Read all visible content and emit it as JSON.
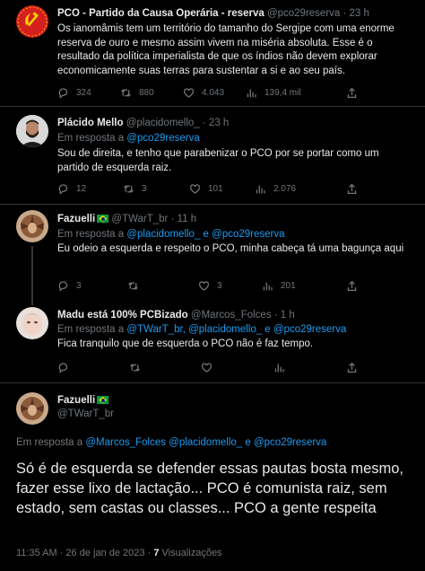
{
  "tweets": [
    {
      "name": "PCO - Partido da Causa Operária - reserva",
      "handle": "@pco29reserva",
      "time": "· 23 h",
      "text": "Os ianomâmis tem um território do tamanho do Sergipe com uma enorme reserva de ouro e mesmo assim vivem na miséria absoluta. Esse é o resultado da política imperialista de que os índios não devem explorar economicamente suas terras para sustentar a si e ao seu país.",
      "replies": "324",
      "retweets": "880",
      "likes": "4.043",
      "views": "139,4 mil"
    },
    {
      "name": "Plácido Mello",
      "handle": "@placidomello_",
      "time": "· 23 h",
      "reply_prefix": "Em resposta a",
      "reply_links": "@pco29reserva",
      "text": "Sou de direita, e tenho que parabenizar o PCO por se portar como um partido de esquerda raiz.",
      "replies": "12",
      "retweets": "3",
      "likes": "101",
      "views": "2.076"
    },
    {
      "name": "Fazuelli",
      "handle": "@TWarT_br",
      "time": "· 11 h",
      "reply_prefix": "Em resposta a",
      "reply_links": "@placidomello_ e @pco29reserva",
      "text": "Eu odeio a esquerda e respeito o PCO, minha cabeça tá uma bagunça aqui",
      "replies": "3",
      "retweets": "",
      "likes": "3",
      "views": "201"
    },
    {
      "name": "Madu está 100% PCBizado",
      "handle": "@Marcos_Folces",
      "time": "· 1 h",
      "reply_prefix": "Em resposta a",
      "reply_links": "@TWarT_br, @placidomello_ e @pco29reserva",
      "text": "Fica tranquilo que de esquerda o PCO não é faz tempo.",
      "replies": "",
      "retweets": "",
      "likes": "",
      "views": ""
    }
  ],
  "main_tweet": {
    "name": "Fazuelli",
    "handle": "@TWarT_br",
    "reply_prefix": "Em resposta a",
    "reply_links": "@Marcos_Folces @placidomello_ e @pco29reserva",
    "text": "Só é de esquerda se defender essas pautas bosta mesmo, fazer esse lixo de lactação... PCO é comunista raiz, sem estado, sem castas ou classes... PCO a gente respeita",
    "timestamp": "11:35 AM · 26 de jan de 2023 ·",
    "views_count": "7",
    "views_label": "Visualizações"
  },
  "colors": {
    "accent": "#1d9bf0",
    "muted": "#71767b",
    "background": "#000000"
  }
}
